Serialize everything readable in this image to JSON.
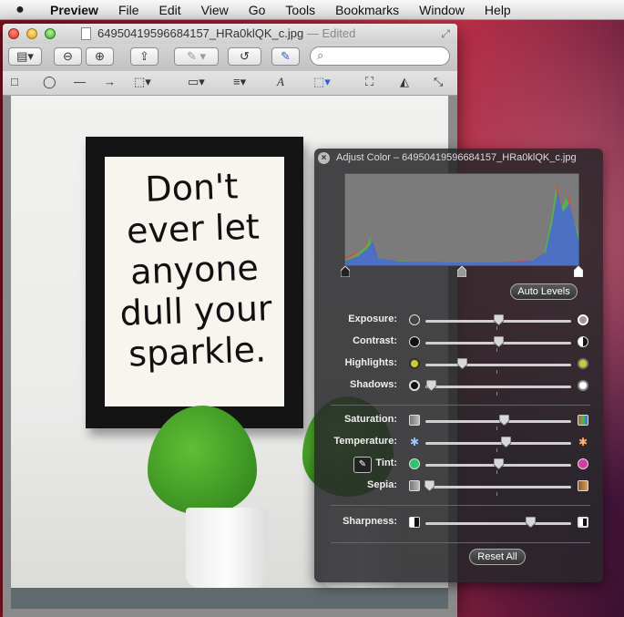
{
  "menubar": {
    "items": [
      "Preview",
      "File",
      "Edit",
      "View",
      "Go",
      "Tools",
      "Bookmarks",
      "Window",
      "Help"
    ]
  },
  "window": {
    "title": "64950419596684157_HRa0klQK_c.jpg",
    "edited": "— Edited"
  },
  "photo": {
    "quote_lines": [
      "Don't",
      "ever let",
      "anyone",
      "dull your",
      "sparkle."
    ]
  },
  "hud": {
    "title": "Adjust Color – 64950419596684157_HRa0klQK_c.jpg",
    "auto_levels": "Auto Levels",
    "reset_all": "Reset All",
    "sliders": [
      {
        "label": "Exposure:",
        "value": 0.5
      },
      {
        "label": "Contrast:",
        "value": 0.5
      },
      {
        "label": "Highlights:",
        "value": 0.25
      },
      {
        "label": "Shadows:",
        "value": 0.04
      },
      {
        "label": "Saturation:",
        "value": 0.54
      },
      {
        "label": "Temperature:",
        "value": 0.55
      },
      {
        "label": "Tint:",
        "value": 0.5
      },
      {
        "label": "Sepia:",
        "value": 0.03
      },
      {
        "label": "Sharpness:",
        "value": 0.72
      }
    ]
  },
  "colors": {
    "hud_bg": "#28282a",
    "histogram_bg": "#7b7b7b",
    "red_channel": "#e04848",
    "green_channel": "#48c048",
    "blue_channel": "#4862e0"
  }
}
